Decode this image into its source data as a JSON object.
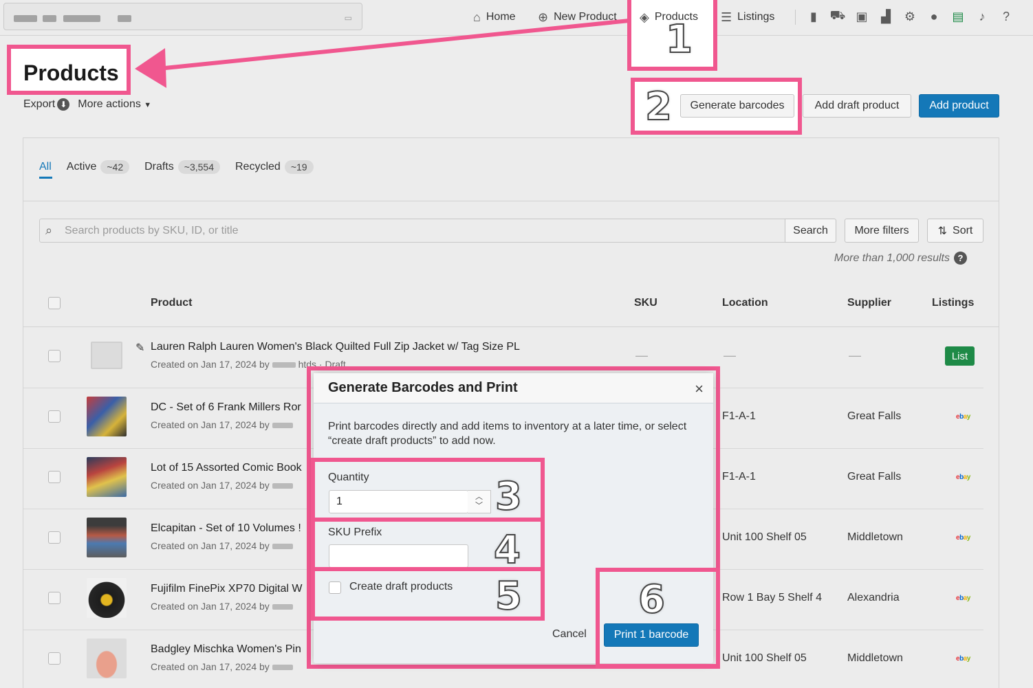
{
  "nav": {
    "home": "Home",
    "new_product": "New Product",
    "products": "Products",
    "listings": "Listings"
  },
  "icons": [
    "clipboard-icon",
    "cart-icon",
    "store-icon",
    "analytics-icon",
    "gear-icon",
    "user-icon",
    "printer-icon",
    "bell-icon",
    "help-icon"
  ],
  "header": {
    "title": "Products",
    "export": "Export",
    "more_actions": "More actions",
    "generate_barcodes": "Generate barcodes",
    "add_draft_product": "Add draft product",
    "add_product": "Add product"
  },
  "tabs": [
    {
      "label": "All",
      "count": ""
    },
    {
      "label": "Active",
      "count": "~42"
    },
    {
      "label": "Drafts",
      "count": "~3,554"
    },
    {
      "label": "Recycled",
      "count": "~19"
    }
  ],
  "search": {
    "placeholder": "Search products by SKU, ID, or title",
    "button": "Search",
    "more_filters": "More filters",
    "sort": "Sort",
    "results_note": "More than 1,000 results"
  },
  "table": {
    "headers": {
      "product": "Product",
      "sku": "SKU",
      "location": "Location",
      "supplier": "Supplier",
      "listings": "Listings"
    },
    "rows": [
      {
        "title": "Lauren Ralph Lauren Women's Black Quilted Full Zip Jacket w/ Tag Size PL",
        "meta": "Created on Jan 17, 2024 by",
        "meta_tail": "htds · Draft",
        "sku": "—",
        "location": "—",
        "supplier": "—",
        "listing": "List"
      },
      {
        "title": "DC - Set of 6 Frank Millers Ror",
        "meta": "Created on Jan 17, 2024 by",
        "location": "F1-A-1",
        "supplier": "Great Falls",
        "listing": "ebay"
      },
      {
        "title": "Lot of 15 Assorted Comic Book",
        "meta": "Created on Jan 17, 2024 by",
        "location": "F1-A-1",
        "supplier": "Great Falls",
        "listing": "ebay"
      },
      {
        "title": "Elcapitan - Set of 10 Volumes !",
        "meta": "Created on Jan 17, 2024 by",
        "location": "Unit 100 Shelf 05",
        "supplier": "Middletown",
        "listing": "ebay"
      },
      {
        "title": "Fujifilm FinePix XP70 Digital W",
        "meta": "Created on Jan 17, 2024 by",
        "location": "Row 1 Bay 5 Shelf 4",
        "supplier": "Alexandria",
        "listing": "ebay"
      },
      {
        "title": "Badgley Mischka Women's Pin",
        "meta": "Created on Jan 17, 2024 by",
        "location": "Unit 100 Shelf 05",
        "supplier": "Middletown",
        "listing": "ebay"
      }
    ]
  },
  "modal": {
    "title": "Generate Barcodes and Print",
    "close": "×",
    "description": "Print barcodes directly and add items to inventory at a later time, or select “create draft products” to add now.",
    "quantity_label": "Quantity",
    "quantity_value": "1",
    "sku_prefix_label": "SKU Prefix",
    "sku_prefix_value": "",
    "create_draft_label": "Create draft products",
    "create_draft_checked": false,
    "cancel": "Cancel",
    "print": "Print 1 barcode"
  },
  "annotations": [
    "1",
    "2",
    "3",
    "4",
    "5",
    "6"
  ],
  "colors": {
    "highlight": "#f0578f",
    "primary": "#1478b8",
    "list_green": "#1e8a47"
  }
}
